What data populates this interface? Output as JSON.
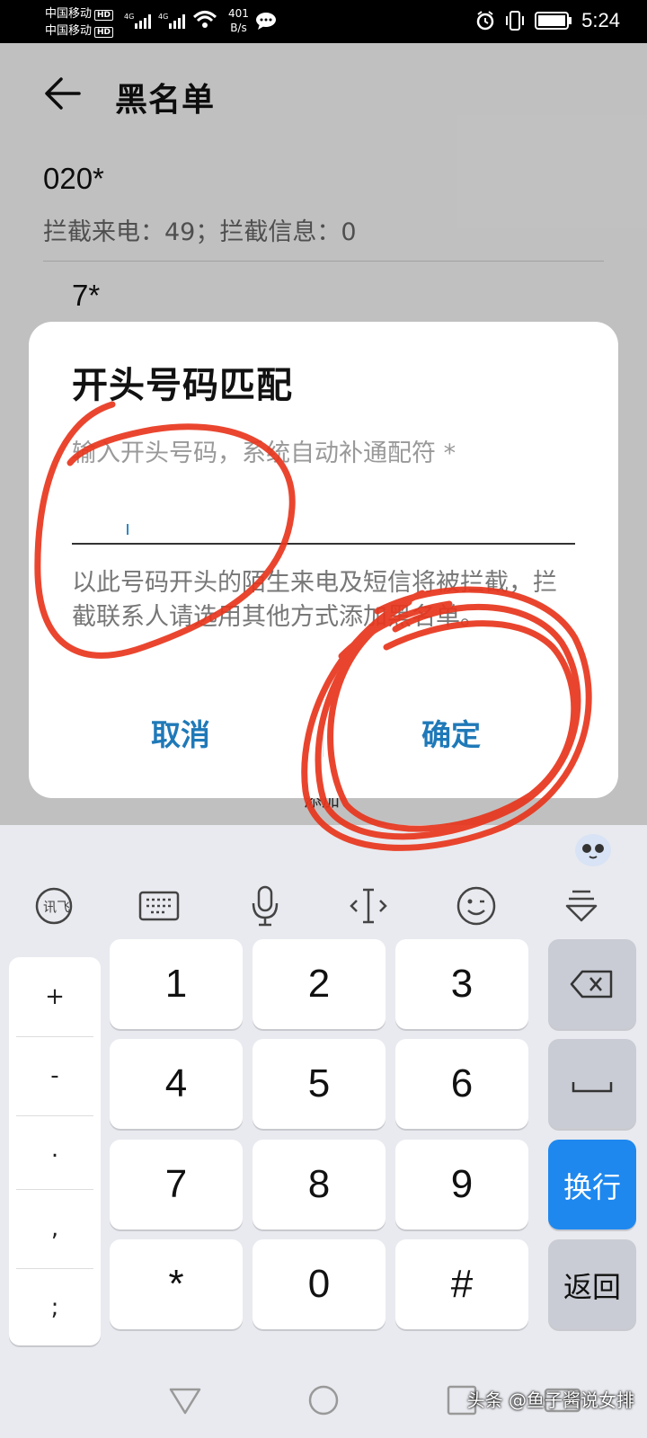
{
  "status_bar": {
    "carrier1": "中国移动",
    "carrier2": "中国移动",
    "hd": "HD",
    "net1": "4G",
    "net2": "4G",
    "speed_value": "401",
    "speed_unit": "B/s",
    "time": "5:24"
  },
  "header": {
    "title": "黑名单"
  },
  "entries": [
    {
      "number": "020*",
      "stats": "拦截来电：49；拦截信息：0"
    },
    {
      "number": "7*"
    }
  ],
  "add_label": "添加",
  "dialog": {
    "title": "开头号码匹配",
    "placeholder": "输入开头号码，系统自动补通配符 *",
    "description": "以此号码开头的陌生来电及短信将被拦截，拦截联系人请选用其他方式添加黑名单。",
    "cancel": "取消",
    "confirm": "确定"
  },
  "keyboard": {
    "toolbar_icons": [
      "handwriting-logo-icon",
      "keyboard-icon",
      "microphone-icon",
      "cursor-move-icon",
      "emoji-icon",
      "collapse-keyboard-icon"
    ],
    "symbols": [
      "+",
      "-",
      ".",
      ",",
      ";"
    ],
    "rows": [
      [
        "1",
        "2",
        "3"
      ],
      [
        "4",
        "5",
        "6"
      ],
      [
        "7",
        "8",
        "9"
      ],
      [
        "*",
        "0",
        "#"
      ]
    ],
    "enter_label": "换行",
    "return_label": "返回"
  },
  "watermark": "头条 @鱼子酱说女排",
  "colors": {
    "accent": "#1f79b8",
    "enter_key": "#1e88ef",
    "scribble": "#e8361d"
  }
}
